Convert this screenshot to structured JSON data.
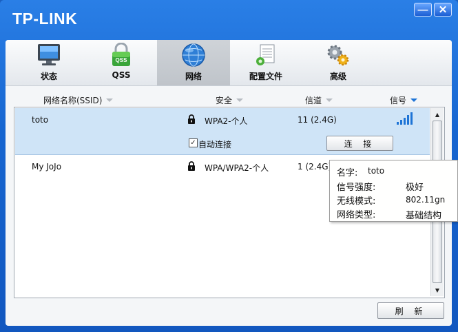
{
  "window": {
    "brand": "TP-LINK",
    "minimize_label": "—",
    "close_label": "✕"
  },
  "nav": {
    "items": [
      {
        "label": "状态",
        "icon": "monitor-icon"
      },
      {
        "label": "QSS",
        "icon": "qss-lock-icon"
      },
      {
        "label": "网络",
        "icon": "globe-icon",
        "active": true
      },
      {
        "label": "配置文件",
        "icon": "profile-file-icon"
      },
      {
        "label": "高级",
        "icon": "gears-icon"
      }
    ]
  },
  "columns": {
    "ssid": "网络名称(SSID)",
    "security": "安全",
    "channel": "信道",
    "signal": "信号"
  },
  "networks": [
    {
      "ssid": "toto",
      "security": "WPA2-个人",
      "channel": "11 (2.4G)",
      "selected": true,
      "auto_connect_label": "自动连接",
      "auto_connect_checked": true,
      "connect_label": "连 接"
    },
    {
      "ssid": "My JoJo",
      "security": "WPA/WPA2-个人",
      "channel": "1 (2.4G)",
      "selected": false
    }
  ],
  "tooltip": {
    "name_label": "名字:",
    "name_value": "toto",
    "strength_label": "信号强度:",
    "strength_value": "极好",
    "mode_label": "无线模式:",
    "mode_value": "802.11gn",
    "type_label": "网络类型:",
    "type_value": "基础结构"
  },
  "refresh_label": "刷 新",
  "colors": {
    "titlebar": "#1665d0",
    "selected_row": "#cfe4f7",
    "signal_bars": "#1e74d6"
  }
}
